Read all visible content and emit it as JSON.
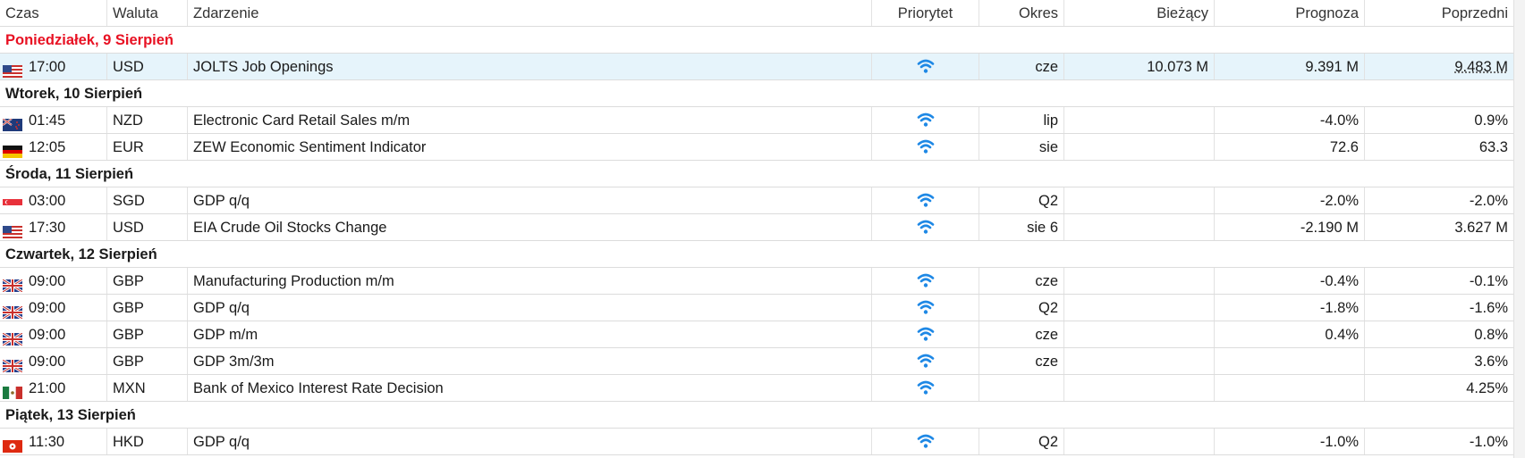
{
  "columns": {
    "time": "Czas",
    "currency": "Waluta",
    "event": "Zdarzenie",
    "priority": "Priorytet",
    "period": "Okres",
    "actual": "Bieżący",
    "forecast": "Prognoza",
    "previous": "Poprzedni"
  },
  "priority_icon": "signal-icon",
  "colors": {
    "today_header": "#e81123",
    "priority_icon": "#1e88e5",
    "selected_row": "#e6f4fb"
  },
  "days": [
    {
      "label": "Poniedziałek, 9 Sierpień",
      "highlight": true,
      "events": [
        {
          "flag": "us-flag-icon",
          "time": "17:00",
          "currency": "USD",
          "event": "JOLTS Job Openings",
          "period": "cze",
          "actual": "10.073 M",
          "forecast": "9.391 M",
          "previous": "9.483 M",
          "selected": true
        }
      ]
    },
    {
      "label": "Wtorek, 10 Sierpień",
      "events": [
        {
          "flag": "nz-flag-icon",
          "time": "01:45",
          "currency": "NZD",
          "event": "Electronic Card Retail Sales m/m",
          "period": "lip",
          "actual": "",
          "forecast": "-4.0%",
          "previous": "0.9%"
        },
        {
          "flag": "de-flag-icon",
          "time": "12:05",
          "currency": "EUR",
          "event": "ZEW Economic Sentiment Indicator",
          "period": "sie",
          "actual": "",
          "forecast": "72.6",
          "previous": "63.3"
        }
      ]
    },
    {
      "label": "Środa, 11 Sierpień",
      "events": [
        {
          "flag": "sg-flag-icon",
          "time": "03:00",
          "currency": "SGD",
          "event": "GDP q/q",
          "period": "Q2",
          "actual": "",
          "forecast": "-2.0%",
          "previous": "-2.0%"
        },
        {
          "flag": "us-flag-icon",
          "time": "17:30",
          "currency": "USD",
          "event": "EIA Crude Oil Stocks Change",
          "period": "sie 6",
          "actual": "",
          "forecast": "-2.190 M",
          "previous": "3.627 M"
        }
      ]
    },
    {
      "label": "Czwartek, 12 Sierpień",
      "events": [
        {
          "flag": "gb-flag-icon",
          "time": "09:00",
          "currency": "GBP",
          "event": "Manufacturing Production m/m",
          "period": "cze",
          "actual": "",
          "forecast": "-0.4%",
          "previous": "-0.1%"
        },
        {
          "flag": "gb-flag-icon",
          "time": "09:00",
          "currency": "GBP",
          "event": "GDP q/q",
          "period": "Q2",
          "actual": "",
          "forecast": "-1.8%",
          "previous": "-1.6%"
        },
        {
          "flag": "gb-flag-icon",
          "time": "09:00",
          "currency": "GBP",
          "event": "GDP m/m",
          "period": "cze",
          "actual": "",
          "forecast": "0.4%",
          "previous": "0.8%"
        },
        {
          "flag": "gb-flag-icon",
          "time": "09:00",
          "currency": "GBP",
          "event": "GDP 3m/3m",
          "period": "cze",
          "actual": "",
          "forecast": "",
          "previous": "3.6%"
        },
        {
          "flag": "mx-flag-icon",
          "time": "21:00",
          "currency": "MXN",
          "event": "Bank of Mexico Interest Rate Decision",
          "period": "",
          "actual": "",
          "forecast": "",
          "previous": "4.25%"
        }
      ]
    },
    {
      "label": "Piątek, 13 Sierpień",
      "events": [
        {
          "flag": "hk-flag-icon",
          "time": "11:30",
          "currency": "HKD",
          "event": "GDP q/q",
          "period": "Q2",
          "actual": "",
          "forecast": "-1.0%",
          "previous": "-1.0%"
        }
      ]
    }
  ]
}
